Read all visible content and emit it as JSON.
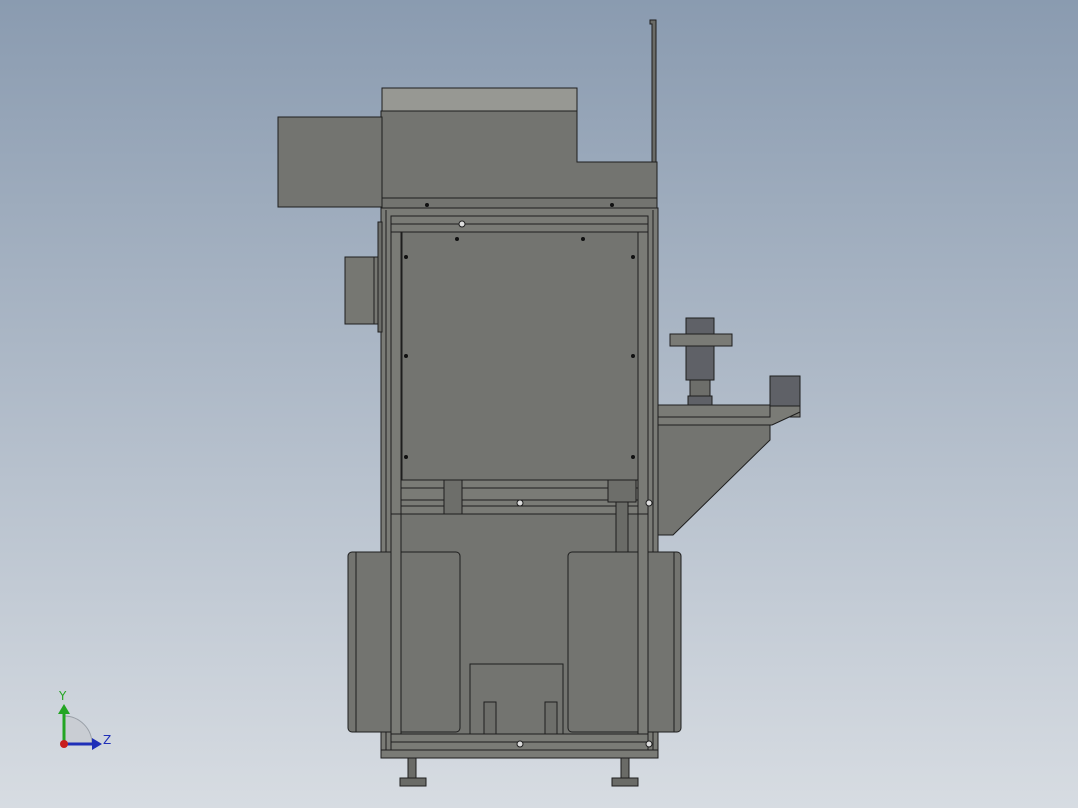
{
  "viewport": {
    "background_top": "#8a9bb0",
    "background_bottom": "#d7dce2"
  },
  "model": {
    "body_color": "#737470",
    "edge_color": "#1e1e1e",
    "top_panel_color": "#979893",
    "motor_color": "#5f6167",
    "frame_color": "#7a7b76"
  },
  "triad": {
    "y_label": "Y",
    "z_label": "Z",
    "y_color": "#23a523",
    "z_color": "#1f2fb8",
    "x_color": "#c81e1e"
  }
}
